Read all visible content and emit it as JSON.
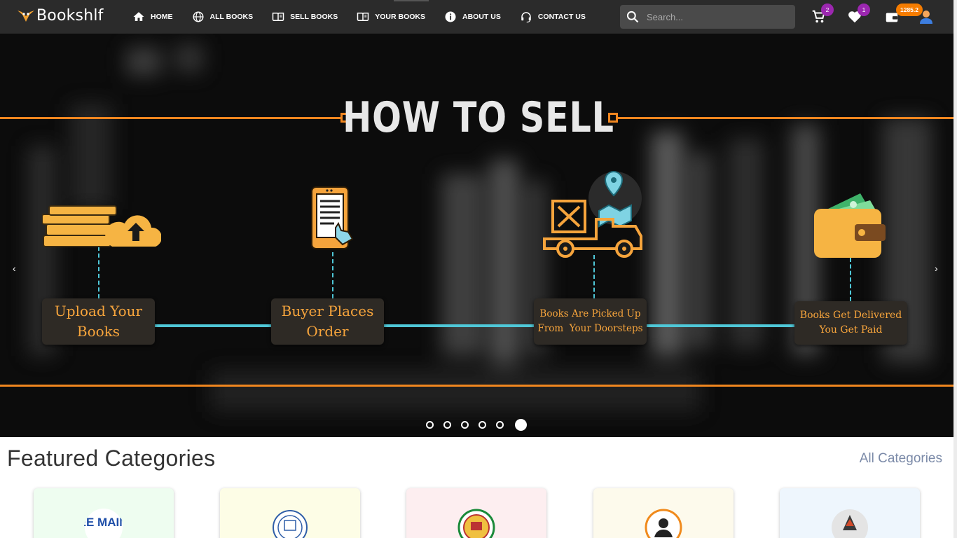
{
  "brand": {
    "name": "Bookshlf"
  },
  "nav": {
    "links": [
      {
        "label": "HOME",
        "icon": "home-icon"
      },
      {
        "label": "ALL BOOKS",
        "icon": "globe-icon"
      },
      {
        "label": "SELL BOOKS",
        "icon": "book-open-icon"
      },
      {
        "label": "YOUR BOOKS",
        "icon": "book-open-icon"
      },
      {
        "label": "ABOUT US",
        "icon": "info-icon"
      },
      {
        "label": "CONTACT US",
        "icon": "headset-icon"
      }
    ],
    "search_placeholder": "Search...",
    "cart_count": "2",
    "wishlist_count": "1",
    "wallet_balance": "1285.2"
  },
  "hero": {
    "title": "HOW TO SELL",
    "steps": [
      {
        "line1": "Upload Your",
        "line2": "Books",
        "icon": "books-cloud-upload-icon"
      },
      {
        "line1": "Buyer Places",
        "line2": "Order",
        "icon": "phone-order-icon"
      },
      {
        "line1": "Books Are Picked Up",
        "line2": "From  Your Doorsteps",
        "icon": "delivery-truck-icon"
      },
      {
        "line1": "Books Get Delivered",
        "line2": "You Get Paid",
        "icon": "wallet-icon"
      }
    ],
    "prev_arrow": "‹",
    "next_arrow": "›",
    "slide_count": 6,
    "active_slide": 6
  },
  "featured": {
    "title": "Featured Categories",
    "all_label": "All Categories",
    "categories": [
      {
        "logo_text": "JEE MAINS",
        "bg": "#eefdf0"
      },
      {
        "logo_text": "",
        "bg": "#fdfde6"
      },
      {
        "logo_text": "",
        "bg": "#fdeef0"
      },
      {
        "logo_text": "",
        "bg": "#fdfaec"
      },
      {
        "logo_text": "",
        "bg": "#eef6fd"
      }
    ]
  },
  "colors": {
    "nav_bg": "#2b2b2b",
    "accent_orange": "#f0861f",
    "accent_cyan": "#4fc8d8",
    "card_text": "#f6a43c",
    "badge_purple": "#9c27b0"
  }
}
